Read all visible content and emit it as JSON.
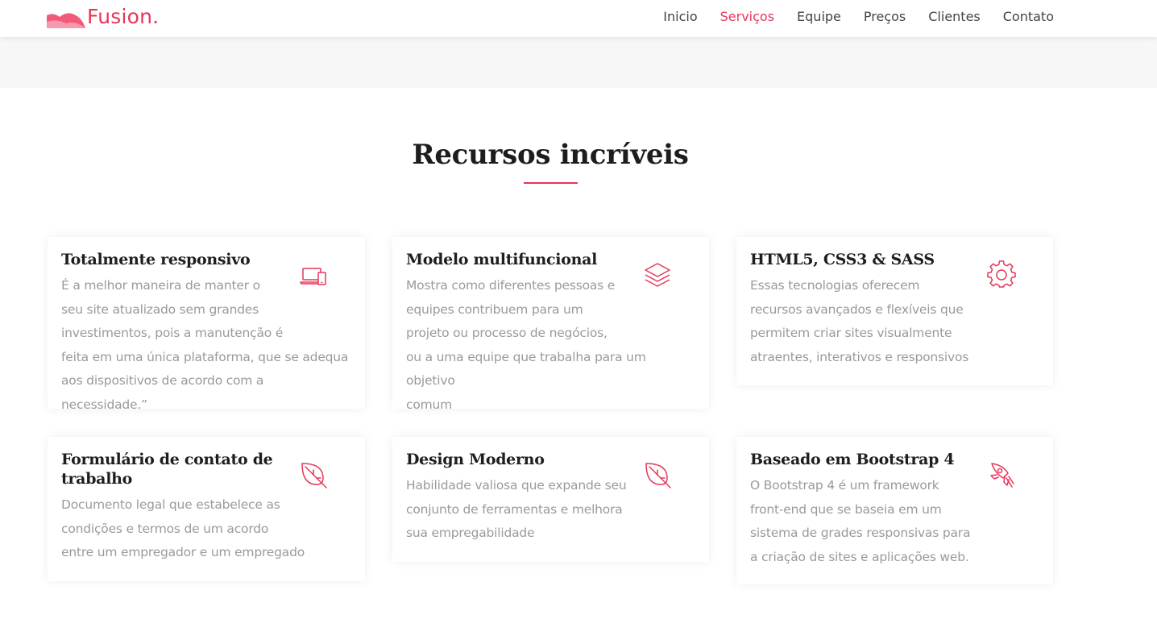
{
  "brand": {
    "name": "Fusion."
  },
  "nav": {
    "items": [
      {
        "label": "Inicio",
        "active": false
      },
      {
        "label": "Serviços",
        "active": true
      },
      {
        "label": "Equipe",
        "active": false
      },
      {
        "label": "Preços",
        "active": false
      },
      {
        "label": "Clientes",
        "active": false
      },
      {
        "label": "Contato",
        "active": false
      }
    ]
  },
  "features": {
    "title": "Recursos incríveis",
    "cards": [
      {
        "title": "Totalmente responsivo",
        "icon": "devices-icon",
        "text": "É a melhor maneira de manter o\nseu site atualizado sem grandes\ninvestimentos, pois a manutenção é\nfeita em uma única plataforma, que se adequa\naos dispositivos de acordo com a necessidade.”"
      },
      {
        "title": "Modelo multifuncional",
        "icon": "layers-icon",
        "text": "Mostra como diferentes pessoas e\nequipes contribuem para um\nprojeto ou processo de negócios,\nou a uma equipe que trabalha para um objetivo\ncomum"
      },
      {
        "title": "HTML5, CSS3 & SASS",
        "icon": "gear-icon",
        "text": "Essas tecnologias oferecem\nrecursos avançados e flexíveis que\npermitem criar sites visualmente\natraentes, interativos e responsivos"
      },
      {
        "title": "Formulário de contato de trabalho",
        "icon": "leaf-icon",
        "text": "Documento legal que estabelece as\ncondições e termos de um acordo\nentre um empregador e um empregado"
      },
      {
        "title": "Design Moderno",
        "icon": "leaf-icon",
        "text": "Habilidade valiosa que expande seu\nconjunto de ferramentas e melhora\nsua empregabilidade"
      },
      {
        "title": "Baseado em Bootstrap 4",
        "icon": "rocket-icon",
        "text": "O Bootstrap 4 é um framework\nfront-end que se baseia em um\nsistema de grades responsivas para\na criação de sites e aplicações web."
      }
    ]
  },
  "colors": {
    "accent": "#e8355a",
    "heading": "#1d1d1d",
    "muted": "#9a9a9a",
    "strip": "#f7f7f7"
  }
}
